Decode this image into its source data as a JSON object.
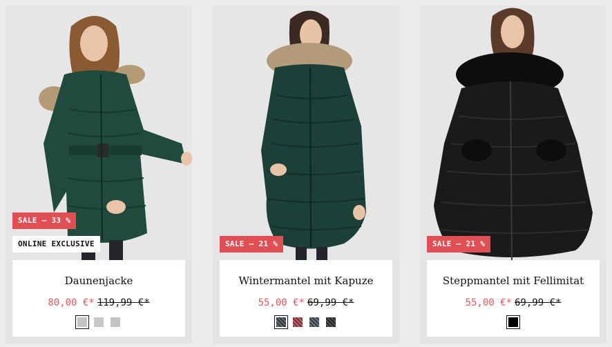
{
  "products": [
    {
      "name": "Daunenjacke",
      "price_current": "80,00 €*",
      "price_old": "119,99 €*",
      "sale_badge": "SALE – 33 %",
      "exclusive_badge": "ONLINE EXCLUSIVE",
      "image_alt": "Woman wearing a dark green belted down jacket with fur-trimmed hood",
      "coat_color": "#1f4a3d",
      "swatches": [
        "#c4c4c4",
        "#c7c8ca",
        "#c2c3c5"
      ],
      "selected_swatch": 0
    },
    {
      "name": "Wintermantel mit Kapuze",
      "price_current": "55,00 €*",
      "price_old": "69,99 €*",
      "sale_badge": "SALE – 21 %",
      "image_alt": "Woman wearing a dark green long quilted winter coat with fur hood",
      "coat_color": "#1c3f37",
      "swatches": [
        "#2b3134",
        "#7a2a33",
        "#2f3a3d",
        "#222426"
      ],
      "selected_swatch": 0
    },
    {
      "name": "Steppmantel mit Fellimitat",
      "price_current": "55,00 €*",
      "price_old": "69,99 €*",
      "sale_badge": "SALE – 21 %",
      "image_alt": "Woman wearing a black long quilted coat with faux fur collar and cuffs",
      "coat_color": "#1a1a1b",
      "swatches": [
        "#000000"
      ],
      "selected_swatch": 0
    }
  ]
}
